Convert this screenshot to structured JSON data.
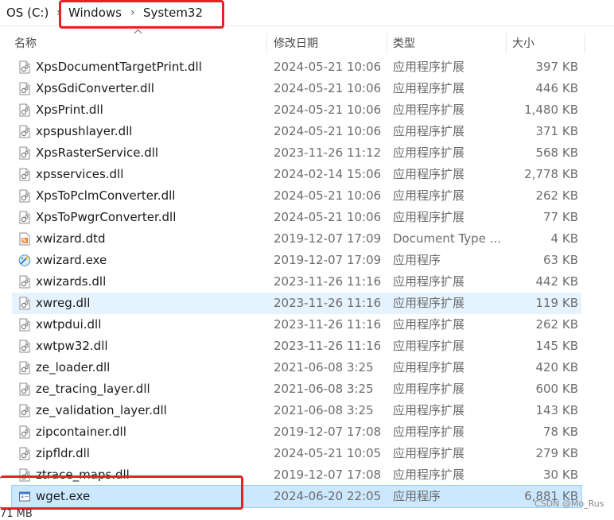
{
  "breadcrumb": {
    "items": [
      "OS (C:)",
      "Windows",
      "System32"
    ],
    "separator": "›"
  },
  "columns": {
    "name": "名称",
    "date": "修改日期",
    "type": "类型",
    "size": "大小"
  },
  "files": [
    {
      "name": "XpsDocumentTargetPrint.dll",
      "date": "2024-05-21 10:06",
      "type": "应用程序扩展",
      "size": "397 KB",
      "icon": "dll-icon"
    },
    {
      "name": "XpsGdiConverter.dll",
      "date": "2024-05-21 10:06",
      "type": "应用程序扩展",
      "size": "446 KB",
      "icon": "dll-icon"
    },
    {
      "name": "XpsPrint.dll",
      "date": "2024-05-21 10:06",
      "type": "应用程序扩展",
      "size": "1,480 KB",
      "icon": "dll-icon"
    },
    {
      "name": "xpspushlayer.dll",
      "date": "2024-05-21 10:06",
      "type": "应用程序扩展",
      "size": "371 KB",
      "icon": "dll-icon"
    },
    {
      "name": "XpsRasterService.dll",
      "date": "2023-11-26 11:12",
      "type": "应用程序扩展",
      "size": "568 KB",
      "icon": "dll-icon"
    },
    {
      "name": "xpsservices.dll",
      "date": "2024-02-14 15:06",
      "type": "应用程序扩展",
      "size": "2,778 KB",
      "icon": "dll-icon"
    },
    {
      "name": "XpsToPclmConverter.dll",
      "date": "2024-05-21 10:06",
      "type": "应用程序扩展",
      "size": "262 KB",
      "icon": "dll-icon"
    },
    {
      "name": "XpsToPwgrConverter.dll",
      "date": "2024-05-21 10:06",
      "type": "应用程序扩展",
      "size": "77 KB",
      "icon": "dll-icon"
    },
    {
      "name": "xwizard.dtd",
      "date": "2019-12-07 17:09",
      "type": "Document Type ...",
      "size": "4 KB",
      "icon": "rss-document-icon"
    },
    {
      "name": "xwizard.exe",
      "date": "2019-12-07 17:09",
      "type": "应用程序",
      "size": "63 KB",
      "icon": "wizard-exe-icon"
    },
    {
      "name": "xwizards.dll",
      "date": "2023-11-26 11:16",
      "type": "应用程序扩展",
      "size": "442 KB",
      "icon": "dll-icon"
    },
    {
      "name": "xwreg.dll",
      "date": "2023-11-26 11:16",
      "type": "应用程序扩展",
      "size": "119 KB",
      "icon": "dll-icon",
      "state": "hover"
    },
    {
      "name": "xwtpdui.dll",
      "date": "2023-11-26 11:16",
      "type": "应用程序扩展",
      "size": "262 KB",
      "icon": "dll-icon"
    },
    {
      "name": "xwtpw32.dll",
      "date": "2023-11-26 11:16",
      "type": "应用程序扩展",
      "size": "145 KB",
      "icon": "dll-icon"
    },
    {
      "name": "ze_loader.dll",
      "date": "2021-06-08 3:25",
      "type": "应用程序扩展",
      "size": "420 KB",
      "icon": "dll-icon"
    },
    {
      "name": "ze_tracing_layer.dll",
      "date": "2021-06-08 3:25",
      "type": "应用程序扩展",
      "size": "600 KB",
      "icon": "dll-icon"
    },
    {
      "name": "ze_validation_layer.dll",
      "date": "2021-06-08 3:25",
      "type": "应用程序扩展",
      "size": "143 KB",
      "icon": "dll-icon"
    },
    {
      "name": "zipcontainer.dll",
      "date": "2019-12-07 17:08",
      "type": "应用程序扩展",
      "size": "78 KB",
      "icon": "dll-icon"
    },
    {
      "name": "zipfldr.dll",
      "date": "2024-05-21 10:05",
      "type": "应用程序扩展",
      "size": "279 KB",
      "icon": "dll-icon"
    },
    {
      "name": "ztrace_maps.dll",
      "date": "2019-12-07 17:08",
      "type": "应用程序扩展",
      "size": "30 KB",
      "icon": "dll-icon"
    },
    {
      "name": "wget.exe",
      "date": "2024-06-20 22:05",
      "type": "应用程序",
      "size": "6,881 KB",
      "icon": "exe-window-icon",
      "state": "selected"
    }
  ],
  "status": {
    "text": "71 MB"
  },
  "watermark": "CSDN @Mo_Rus",
  "colors": {
    "highlight": "#e32323",
    "hover_row": "#e5f3ff",
    "selected_row": "#cce8ff"
  }
}
